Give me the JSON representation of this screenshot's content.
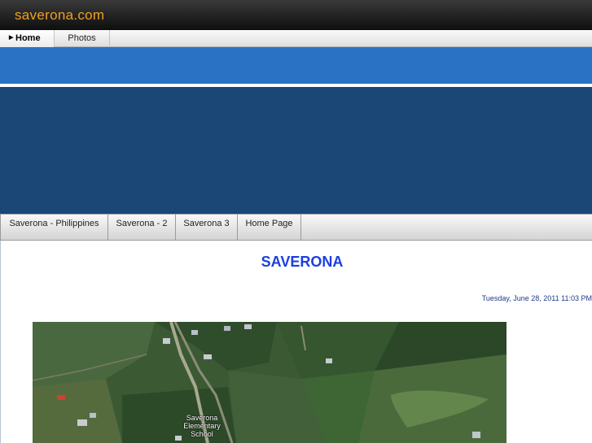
{
  "site": {
    "title": "saverona.com"
  },
  "nav": {
    "items": [
      {
        "label": "Home",
        "active": true
      },
      {
        "label": "Photos",
        "active": false
      }
    ]
  },
  "subnav": {
    "items": [
      {
        "label": "Saverona - Philippines"
      },
      {
        "label": "Saverona - 2"
      },
      {
        "label": "Saverona 3"
      },
      {
        "label": "Home Page"
      }
    ]
  },
  "content": {
    "title": "SAVERONA",
    "date": "Tuesday, June 28, 2011 11:03 PM"
  },
  "map": {
    "label_lines": [
      "Saverona",
      "Elementary",
      "School"
    ],
    "icon": "map-pin-icon"
  },
  "colors": {
    "topbar": "#1a1a1a",
    "site_title": "#f0a020",
    "banner_light": "#2a72c4",
    "banner_dark": "#1b4777",
    "page_title": "#1a3fe0"
  }
}
